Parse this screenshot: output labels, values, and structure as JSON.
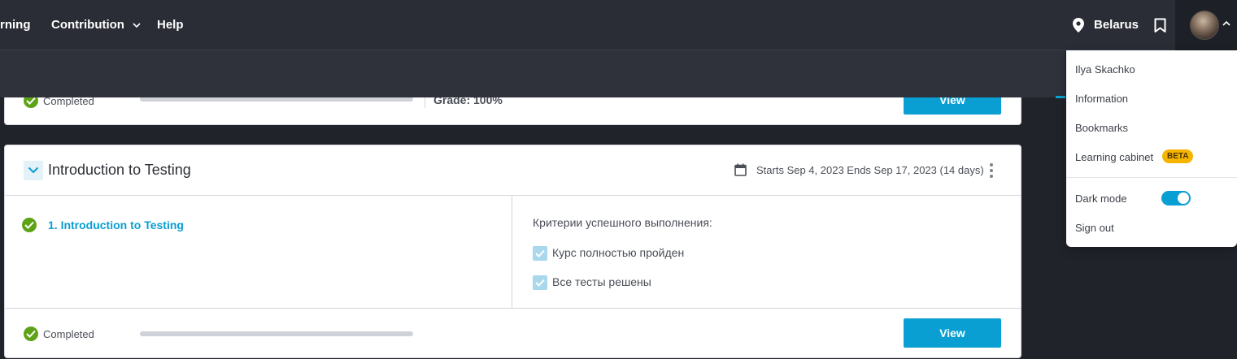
{
  "nav": {
    "learning_partial": "rning",
    "contribution": "Contribution",
    "help": "Help",
    "location": "Belarus"
  },
  "top_card": {
    "status": "Completed",
    "grade": "Grade: 100%",
    "view_label": "View"
  },
  "course": {
    "title": "Introduction to Testing",
    "dates": "Starts Sep 4, 2023 Ends Sep 17, 2023 (14 days)",
    "lesson": "1. Introduction to Testing",
    "criteria_title": "Критерии успешного выполнения:",
    "criteria": [
      "Курс полностью пройден",
      "Все тесты решены"
    ],
    "status": "Completed",
    "view_label": "View"
  },
  "user_menu": {
    "user_name": "Ilya Skachko",
    "information": "Information",
    "bookmarks": "Bookmarks",
    "learning_cabinet": "Learning cabinet",
    "beta": "BETA",
    "dark_mode": "Dark mode",
    "dark_mode_on": true,
    "sign_out": "Sign out"
  },
  "colors": {
    "accent": "#0a9fd3",
    "success": "#5ea317",
    "beta": "#f5b400",
    "nav_bg": "#2b2d36"
  }
}
